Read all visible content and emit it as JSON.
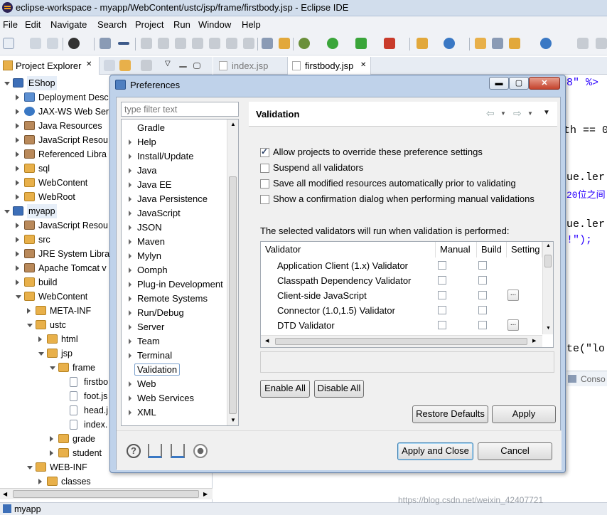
{
  "window": {
    "title": "eclipse-workspace - myapp/WebContent/ustc/jsp/frame/firstbody.jsp - Eclipse IDE"
  },
  "menu": [
    "File",
    "Edit",
    "Navigate",
    "Search",
    "Project",
    "Run",
    "Window",
    "Help"
  ],
  "project_explorer": {
    "tab_label": "Project Explorer",
    "tab_close": "✕",
    "items": [
      {
        "label": "EShop",
        "icon": "project-icon"
      },
      {
        "label": "Deployment Desc",
        "icon": "deploy-icon"
      },
      {
        "label": "JAX-WS Web Ser",
        "icon": "webservice-icon"
      },
      {
        "label": "Java Resources",
        "icon": "java-resources-icon"
      },
      {
        "label": "JavaScript Resou",
        "icon": "js-resources-icon"
      },
      {
        "label": "Referenced Libra",
        "icon": "library-icon"
      },
      {
        "label": "sql",
        "icon": "folder-icon"
      },
      {
        "label": "WebContent",
        "icon": "folder-icon"
      },
      {
        "label": "WebRoot",
        "icon": "folder-icon"
      },
      {
        "label": "myapp",
        "icon": "project-icon"
      },
      {
        "label": "JavaScript Resou",
        "icon": "js-resources-icon"
      },
      {
        "label": "src",
        "icon": "package-folder-icon"
      },
      {
        "label": "JRE System Libra",
        "icon": "library-icon"
      },
      {
        "label": "Apache Tomcat v",
        "icon": "library-icon"
      },
      {
        "label": "build",
        "icon": "folder-icon"
      },
      {
        "label": "WebContent",
        "icon": "folder-icon"
      },
      {
        "label": "META-INF",
        "icon": "folder-icon"
      },
      {
        "label": "ustc",
        "icon": "folder-icon"
      },
      {
        "label": "html",
        "icon": "folder-icon"
      },
      {
        "label": "jsp",
        "icon": "folder-icon"
      },
      {
        "label": "frame",
        "icon": "folder-icon"
      },
      {
        "label": "firstbo",
        "icon": "file-icon"
      },
      {
        "label": "foot.js",
        "icon": "file-icon"
      },
      {
        "label": "head.j",
        "icon": "file-icon"
      },
      {
        "label": "index.",
        "icon": "file-icon"
      },
      {
        "label": "grade",
        "icon": "folder-icon"
      },
      {
        "label": "student",
        "icon": "folder-icon"
      },
      {
        "label": "WEB-INF",
        "icon": "folder-icon"
      },
      {
        "label": "classes",
        "icon": "folder-icon"
      }
    ]
  },
  "editor": {
    "tabs": [
      "index.jsp",
      "firstbody.jsp"
    ],
    "code_fragments": [
      "8\" %>",
      "th == 0",
      "ue.ler",
      "20位之间",
      "ue.ler",
      "!\");",
      "te(\"lo"
    ],
    "console_tab": "Conso"
  },
  "status_bar": {
    "text": "myapp"
  },
  "watermark": "https://blog.csdn.net/weixin_42407721",
  "dialog": {
    "title": "Preferences",
    "filter_placeholder": "type filter text",
    "nav_items": [
      "Gradle",
      "Help",
      "Install/Update",
      "Java",
      "Java EE",
      "Java Persistence",
      "JavaScript",
      "JSON",
      "Maven",
      "Mylyn",
      "Oomph",
      "Plug-in Development",
      "Remote Systems",
      "Run/Debug",
      "Server",
      "Team",
      "Terminal",
      "Validation",
      "Web",
      "Web Services",
      "XML"
    ],
    "selected_nav": "Validation",
    "page_title": "Validation",
    "options": [
      {
        "label": "Allow projects to override these preference settings",
        "checked": true
      },
      {
        "label": "Suspend all validators",
        "checked": false
      },
      {
        "label": "Save all modified resources automatically prior to validating",
        "checked": false
      },
      {
        "label": "Show a confirmation dialog when performing manual validations",
        "checked": false
      }
    ],
    "table_caption": "The selected validators will run when validation is performed:",
    "table_headers": [
      "Validator",
      "Manual",
      "Build",
      "Setting"
    ],
    "validators": [
      {
        "name": "Application Client (1.x) Validator",
        "manual": false,
        "build": false,
        "settings": false
      },
      {
        "name": "Classpath Dependency Validator",
        "manual": false,
        "build": false,
        "settings": false
      },
      {
        "name": "Client-side JavaScript",
        "manual": false,
        "build": false,
        "settings": true
      },
      {
        "name": "Connector (1.0,1.5) Validator",
        "manual": false,
        "build": false,
        "settings": false
      },
      {
        "name": "DTD Validator",
        "manual": false,
        "build": false,
        "settings": true
      }
    ],
    "settings_glyph": "...",
    "buttons": {
      "enable_all": "Enable All",
      "disable_all": "Disable All",
      "restore_defaults": "Restore Defaults",
      "apply": "Apply",
      "apply_close": "Apply and Close",
      "cancel": "Cancel"
    }
  }
}
